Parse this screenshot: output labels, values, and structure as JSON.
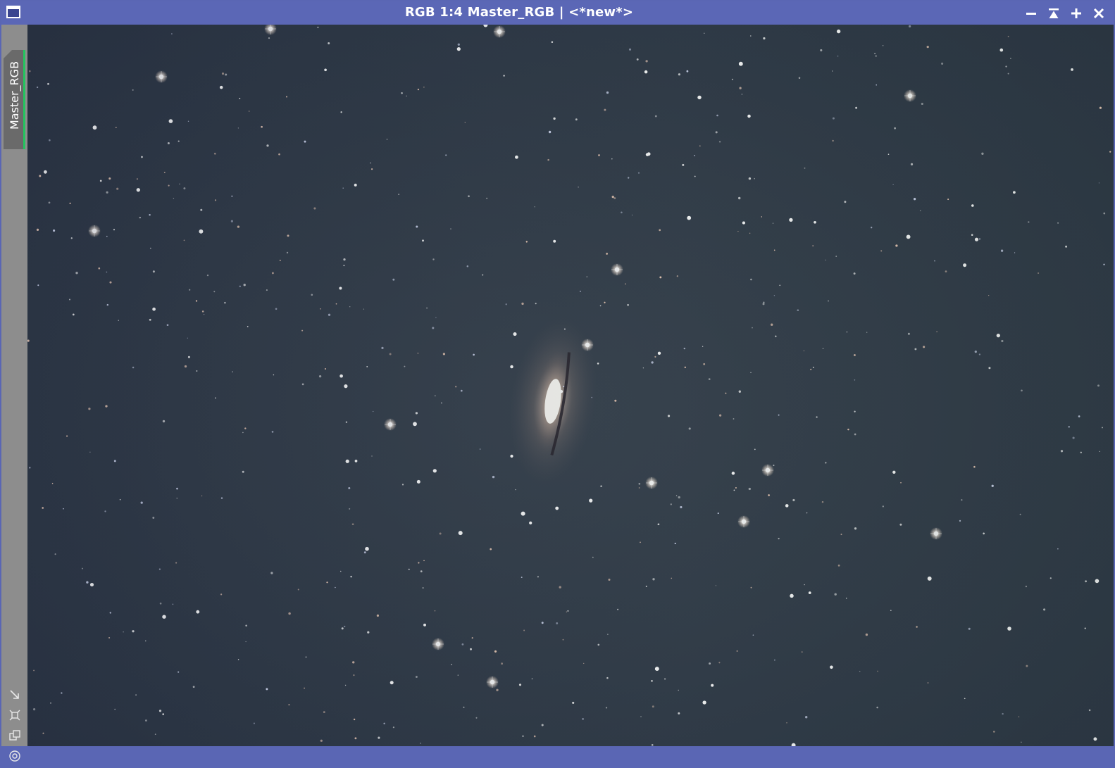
{
  "window": {
    "title": "RGB 1:4 Master_RGB | <*new*>",
    "controls": {
      "minimize": "−",
      "shade": "⩠",
      "maximize": "+",
      "close": "✕"
    }
  },
  "sidebar": {
    "view_tab_label": "Master_RGB",
    "tools": [
      "resize-arrow-icon",
      "fit-view-icon",
      "clone-view-icon",
      "target-icon"
    ]
  },
  "colors": {
    "titlebar": "#5b67b6",
    "sky": "#333d4a",
    "tab_accent": "#22c55e",
    "sidebar": "#8d8d8d"
  }
}
